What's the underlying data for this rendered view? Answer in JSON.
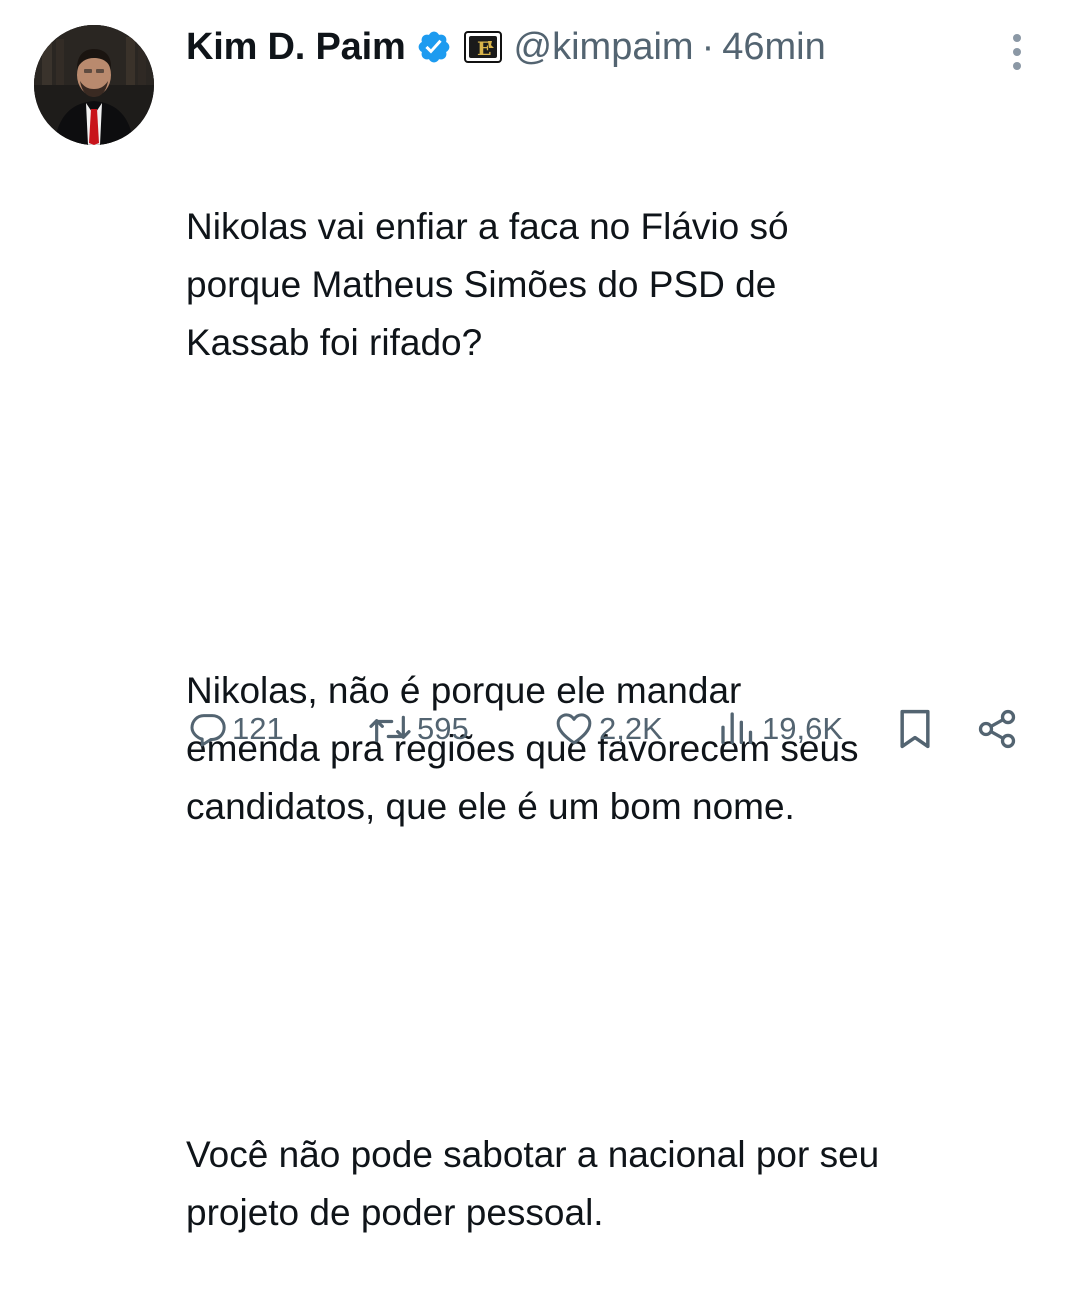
{
  "tweet": {
    "author_name": "Kim D. Paim",
    "handle": "@kimpaim",
    "separator": "·",
    "time": "46min",
    "paragraphs": [
      "Nikolas vai enfiar a faca no Flávio só\nporque Matheus Simões do PSD de\nKassab foi rifado?",
      "Nikolas, não é porque ele mandar\nemenda pra regiões que favorecem seus\ncandidatos, que ele é um bom nome.",
      "Você não pode sabotar a nacional por seu\nprojeto de poder pessoal."
    ]
  },
  "metrics": {
    "replies": "121",
    "retweets": "595",
    "likes": "2,2K",
    "views": "19,6K"
  },
  "icons": {
    "verified": "verified-badge-icon",
    "affiliate": "affiliate-badge-icon",
    "more": "more-vertical-icon",
    "reply": "reply-icon",
    "retweet": "retweet-icon",
    "like": "heart-icon",
    "views": "views-icon",
    "bookmark": "bookmark-icon",
    "share": "share-icon"
  },
  "colors": {
    "text": "#0f1419",
    "secondary": "#536471",
    "verified": "#1d9bf0"
  }
}
